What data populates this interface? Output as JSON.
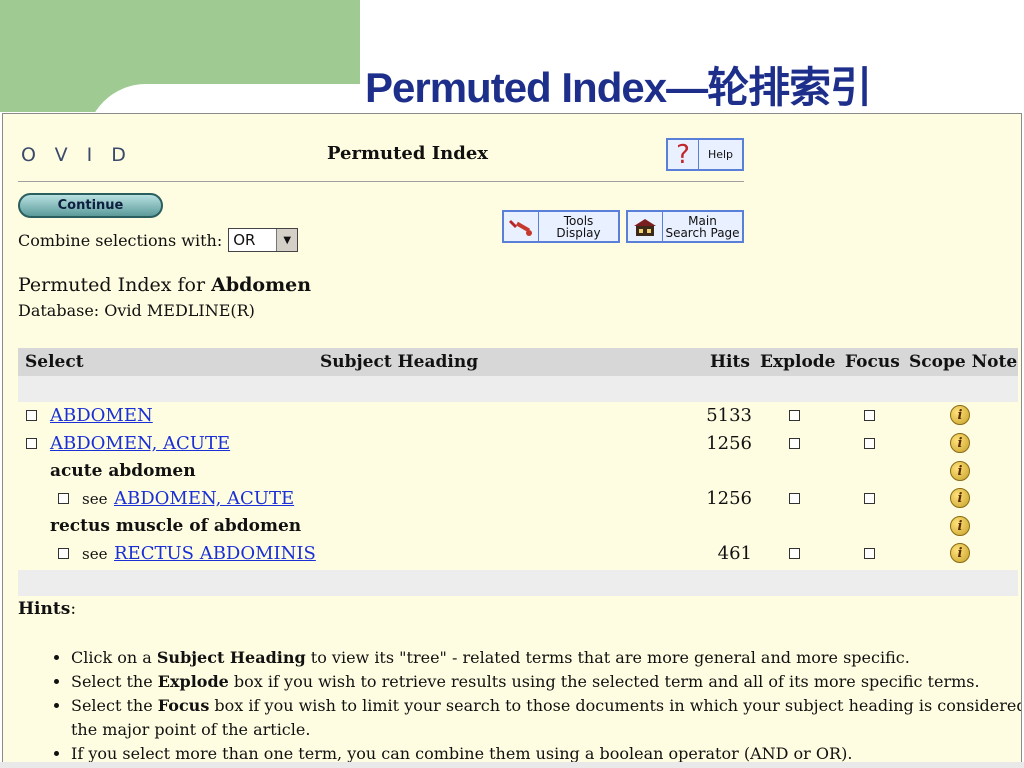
{
  "slide": {
    "title": "Permuted Index—轮排索引"
  },
  "app": {
    "logo_letters": "OVID",
    "page_header": "Permuted Index"
  },
  "buttons": {
    "help_glyph": "?",
    "help_label": "Help",
    "continue_label": "Continue",
    "tools_line1": "Tools",
    "tools_line2": "Display",
    "main_line1": "Main",
    "main_line2": "Search Page"
  },
  "combine": {
    "label": "Combine selections with:",
    "value": "OR",
    "arrow": "▼"
  },
  "index": {
    "title_prefix": "Permuted Index for ",
    "term": "Abdomen",
    "database": "Database: Ovid MEDLINE(R)"
  },
  "table": {
    "headers": {
      "select": "Select",
      "subject": "Subject Heading",
      "hits": "Hits",
      "explode": "Explode",
      "focus": "Focus",
      "scope": "Scope Note"
    },
    "rows": [
      {
        "heading": "ABDOMEN",
        "hits": "5133"
      },
      {
        "heading": "ABDOMEN, ACUTE",
        "hits": "1256"
      },
      {
        "label": "acute abdomen"
      },
      {
        "see": "see",
        "heading": "ABDOMEN, ACUTE",
        "hits": "1256"
      },
      {
        "label": "rectus muscle of abdomen"
      },
      {
        "see": "see",
        "heading": "RECTUS ABDOMINIS",
        "hits": "461"
      }
    ],
    "info_glyph": "i"
  },
  "hints": {
    "title": "Hints",
    "colon": ":",
    "items": [
      {
        "pre": "Click on a ",
        "bold": "Subject Heading",
        "post": " to view its \"tree\" - related terms that are more general and more specific."
      },
      {
        "pre": "Select the ",
        "bold": "Explode",
        "post": " box if you wish to retrieve results using the selected term and all of its more specific terms."
      },
      {
        "pre": "Select the ",
        "bold": "Focus",
        "post": " box if you wish to limit your search to those documents in which your subject heading is considered the major point of the article."
      },
      {
        "pre": "If you select more than one term, you can combine them using a boolean operator (AND or OR)."
      }
    ]
  }
}
